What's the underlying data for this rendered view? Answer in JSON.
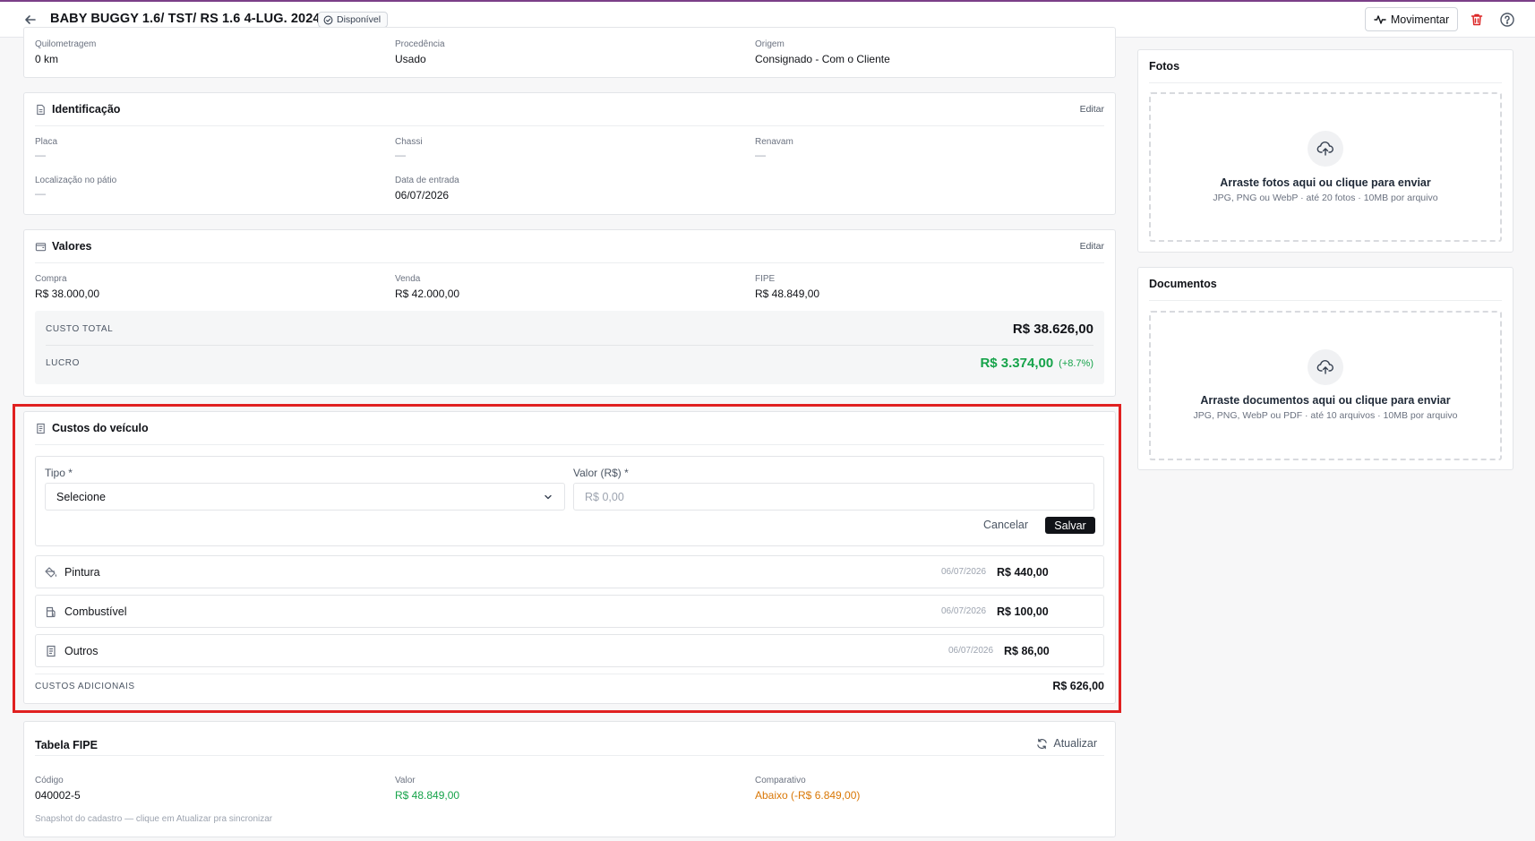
{
  "header": {
    "title": "BABY BUGGY 1.6/ TST/ RS 1.6 4-LUG. 2024",
    "status": "Disponível",
    "move_label": "Movimentar"
  },
  "top_fields": [
    {
      "label": "Quilometragem",
      "value": "0 km"
    },
    {
      "label": "Procedência",
      "value": "Usado"
    },
    {
      "label": "Origem",
      "value": "Consignado - Com o Cliente"
    }
  ],
  "identificacao": {
    "title": "Identificação",
    "edit": "Editar",
    "fields": [
      {
        "label": "Placa",
        "value": "—"
      },
      {
        "label": "Chassi",
        "value": "—"
      },
      {
        "label": "Renavam",
        "value": "—"
      },
      {
        "label": "Localização no pátio",
        "value": "—"
      },
      {
        "label": "Data de entrada",
        "value": "06/07/2026"
      }
    ]
  },
  "valores": {
    "title": "Valores",
    "edit": "Editar",
    "fields": [
      {
        "label": "Compra",
        "value": "R$ 38.000,00"
      },
      {
        "label": "Venda",
        "value": "R$ 42.000,00"
      },
      {
        "label": "FIPE",
        "value": "R$ 48.849,00"
      }
    ],
    "custo_total_label": "CUSTO TOTAL",
    "custo_total_value": "R$ 38.626,00",
    "lucro_label": "LUCRO",
    "lucro_value": "R$ 3.374,00",
    "lucro_pct": "(+8.7%)"
  },
  "custos": {
    "title": "Custos do veículo",
    "tipo_label": "Tipo *",
    "tipo_value": "Selecione",
    "valor_label": "Valor (R$) *",
    "valor_placeholder": "R$ 0,00",
    "cancel_label": "Cancelar",
    "save_label": "Salvar",
    "items": [
      {
        "name": "Pintura",
        "date": "06/07/2026",
        "amount": "R$ 440,00"
      },
      {
        "name": "Combustível",
        "date": "06/07/2026",
        "amount": "R$ 100,00"
      },
      {
        "name": "Outros",
        "date": "06/07/2026",
        "amount": "R$ 86,00"
      }
    ],
    "total_label": "CUSTOS ADICIONAIS",
    "total_value": "R$ 626,00"
  },
  "fipe": {
    "title": "Tabela FIPE",
    "refresh_label": "Atualizar",
    "fields": [
      {
        "label": "Código",
        "value": "040002-5"
      },
      {
        "label": "Valor",
        "value": "R$ 48.849,00"
      },
      {
        "label": "Comparativo",
        "value": "Abaixo (-R$ 6.849,00)"
      }
    ],
    "note": "Snapshot do cadastro — clique em Atualizar pra sincronizar"
  },
  "fotos": {
    "title": "Fotos",
    "main": "Arraste fotos aqui ou clique para enviar",
    "sub": "JPG, PNG ou WebP · até 20 fotos · 10MB por arquivo"
  },
  "documentos": {
    "title": "Documentos",
    "main": "Arraste documentos aqui ou clique para enviar",
    "sub": "JPG, PNG, WebP ou PDF · até 10 arquivos · 10MB por arquivo"
  },
  "colors": {
    "accent_purple": "#7b3f88",
    "profit_green": "#16a34a",
    "fipe_green": "#16a34a",
    "warning_orange": "#d97706",
    "danger_red": "#dc2626",
    "highlight_red": "#e02020"
  },
  "icons": {
    "back": "arrow-left-icon",
    "status": "check-circle-icon",
    "move": "activity-icon",
    "delete": "trash-icon",
    "help": "help-circle-icon",
    "upload": "cloud-upload-icon"
  }
}
